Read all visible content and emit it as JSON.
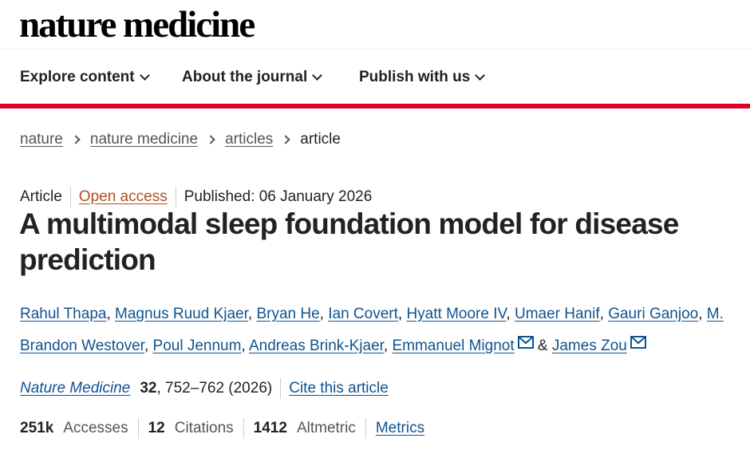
{
  "brand": {
    "logo_text": "nature medicine"
  },
  "nav": {
    "items": [
      {
        "label": "Explore content"
      },
      {
        "label": "About the journal"
      },
      {
        "label": "Publish with us"
      }
    ]
  },
  "breadcrumb": {
    "items": [
      "nature",
      "nature medicine",
      "articles"
    ],
    "current": "article"
  },
  "article": {
    "type": "Article",
    "access": "Open access",
    "published": "Published: 06 January 2026",
    "title": "A multimodal sleep foundation model for disease prediction",
    "authors": [
      "Rahul Thapa",
      "Magnus Ruud Kjaer",
      "Bryan He",
      "Ian Covert",
      "Hyatt Moore IV",
      "Umaer Hanif",
      "Gauri Ganjoo",
      "M. Brandon Westover",
      "Poul Jennum",
      "Andreas Brink-Kjaer",
      "Emmanuel Mignot",
      "James Zou"
    ],
    "author_separator": ",",
    "author_and": "&",
    "citation": {
      "journal": "Nature Medicine",
      "volume": "32",
      "pages_year": ", 752–762 (2026)",
      "cite_label": "Cite this article"
    },
    "metrics": {
      "accesses_value": "251k",
      "accesses_label": "Accesses",
      "citations_value": "12",
      "citations_label": "Citations",
      "altmetric_value": "1412",
      "altmetric_label": "Altmetric",
      "metrics_link": "Metrics"
    }
  },
  "colors": {
    "accent_red": "#e0002a",
    "link_blue": "#0f5391",
    "open_access_orange": "#b44d1d"
  },
  "icons": {
    "nav_chevron": "chevron-down-icon",
    "breadcrumb_separator": "chevron-right-icon",
    "corresponding_author": "mail-icon"
  }
}
